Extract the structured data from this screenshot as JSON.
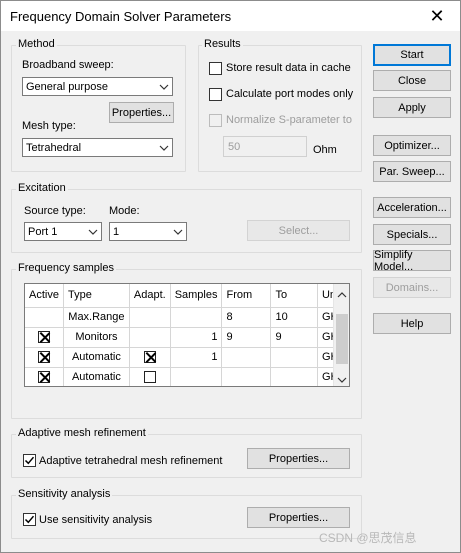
{
  "window": {
    "title": "Frequency Domain Solver Parameters"
  },
  "method": {
    "group_title": "Method",
    "broadband_label": "Broadband sweep:",
    "broadband_value": "General purpose",
    "properties_label": "Properties...",
    "mesh_label": "Mesh type:",
    "mesh_value": "Tetrahedral"
  },
  "results": {
    "group_title": "Results",
    "store_label": "Store result data in cache",
    "port_modes_label": "Calculate port modes only",
    "normalize_label": "Normalize S-parameter to",
    "normalize_value": "50",
    "unit": "Ohm"
  },
  "actions": {
    "start": "Start",
    "close": "Close",
    "apply": "Apply",
    "optimizer": "Optimizer...",
    "par_sweep": "Par. Sweep...",
    "acceleration": "Acceleration...",
    "specials": "Specials...",
    "simplify_model": "Simplify Model...",
    "domains": "Domains...",
    "help": "Help"
  },
  "excitation": {
    "group_title": "Excitation",
    "source_label": "Source type:",
    "source_value": "Port 1",
    "mode_label": "Mode:",
    "mode_value": "1",
    "select_label": "Select..."
  },
  "frequency": {
    "group_title": "Frequency samples",
    "columns": [
      "Active",
      "Type",
      "Adapt.",
      "Samples",
      "From",
      "To",
      "Unit"
    ],
    "rows": [
      {
        "active": "",
        "type": "Max.Range",
        "adapt": "",
        "samples": "",
        "from": "8",
        "to": "10",
        "unit": "GHz"
      },
      {
        "active": "checked",
        "type": "Monitors",
        "adapt": "",
        "samples": "1",
        "from": "9",
        "to": "9",
        "unit": "GHz"
      },
      {
        "active": "checked",
        "type": "Automatic",
        "adapt": "checked",
        "samples": "1",
        "from": "",
        "to": "",
        "unit": "GHz"
      },
      {
        "active": "checked",
        "type": "Automatic",
        "adapt": "unchecked",
        "samples": "",
        "from": "",
        "to": "",
        "unit": "GHz"
      }
    ]
  },
  "adaptive": {
    "group_title": "Adaptive mesh refinement",
    "check_label": "Adaptive tetrahedral mesh refinement",
    "properties_label": "Properties..."
  },
  "sensitivity": {
    "group_title": "Sensitivity analysis",
    "check_label": "Use sensitivity analysis",
    "properties_label": "Properties..."
  },
  "watermark": "CSDN @思茂信息"
}
